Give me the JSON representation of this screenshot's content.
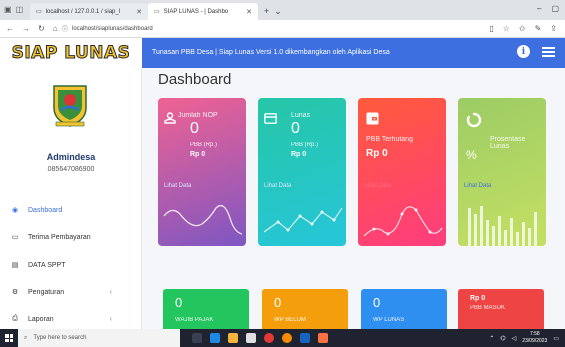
{
  "browser": {
    "tabs": [
      {
        "label": "localhost / 127.0.0.1 / siap_l",
        "active": false
      },
      {
        "label": "SIAP LUNAS - | Dashbo",
        "active": true
      }
    ],
    "new_tab_icon": "plus-icon",
    "url": "localhost/siaplunas/dashboard",
    "colors": {
      "chrome": "#dfe3e8"
    }
  },
  "header": {
    "brand": "SIAP LUNAS",
    "marquee": "Tunasan PBB Desa | Siap Lunas Versi 1.0 dikembangkan oleh Aplikasi Desa",
    "accent": "#3d6fe0"
  },
  "sidebar": {
    "user_name": "Admindesa",
    "user_phone": "085647086900",
    "items": [
      {
        "label": "Dashboard",
        "icon": "dashboard-icon",
        "active": true
      },
      {
        "label": "Terima Pembayaran",
        "icon": "cash-icon",
        "active": false
      },
      {
        "label": "DATA SPPT",
        "icon": "document-icon",
        "active": false
      },
      {
        "label": "Pengaturan",
        "icon": "gear-icon",
        "active": false,
        "has_submenu": true
      },
      {
        "label": "Laporan",
        "icon": "print-icon",
        "active": false,
        "has_submenu": true
      }
    ]
  },
  "main": {
    "title": "Dashboard",
    "cards": [
      {
        "label": "Jumlah NOP",
        "count": "0",
        "sub_label": "PBB (Rp.)",
        "amount": "Rp 0",
        "link": "Lihat Data",
        "icon": "user-icon"
      },
      {
        "label": "Lunas",
        "count": "0",
        "sub_label": "PBB (Rp.)",
        "amount": "Rp 0",
        "link": "Lihat Data",
        "icon": "card-icon"
      },
      {
        "label": "PBB Terhutang",
        "count": "",
        "sub_label": "",
        "amount": "Rp 0",
        "link": "Lihat Data",
        "icon": "wallet-icon"
      },
      {
        "label": "Prosentase Lunas",
        "count": "%",
        "sub_label": "",
        "amount": "",
        "link": "Lihat Data",
        "icon": "circle-notch-icon"
      }
    ],
    "stats": [
      {
        "value": "0",
        "label": "WAJIB PAJAK",
        "color": "#22c55e"
      },
      {
        "value": "0",
        "label": "WP BELUM",
        "color": "#f59e0b"
      },
      {
        "value": "0",
        "label": "WP LUNAS",
        "color": "#2f8ff0"
      },
      {
        "value": "Rp 0",
        "label": "PBB MASUK",
        "color": "#ef4444"
      }
    ]
  },
  "taskbar": {
    "search_placeholder": "Type here to search",
    "time": "7:58",
    "date": "23/09/2023"
  }
}
